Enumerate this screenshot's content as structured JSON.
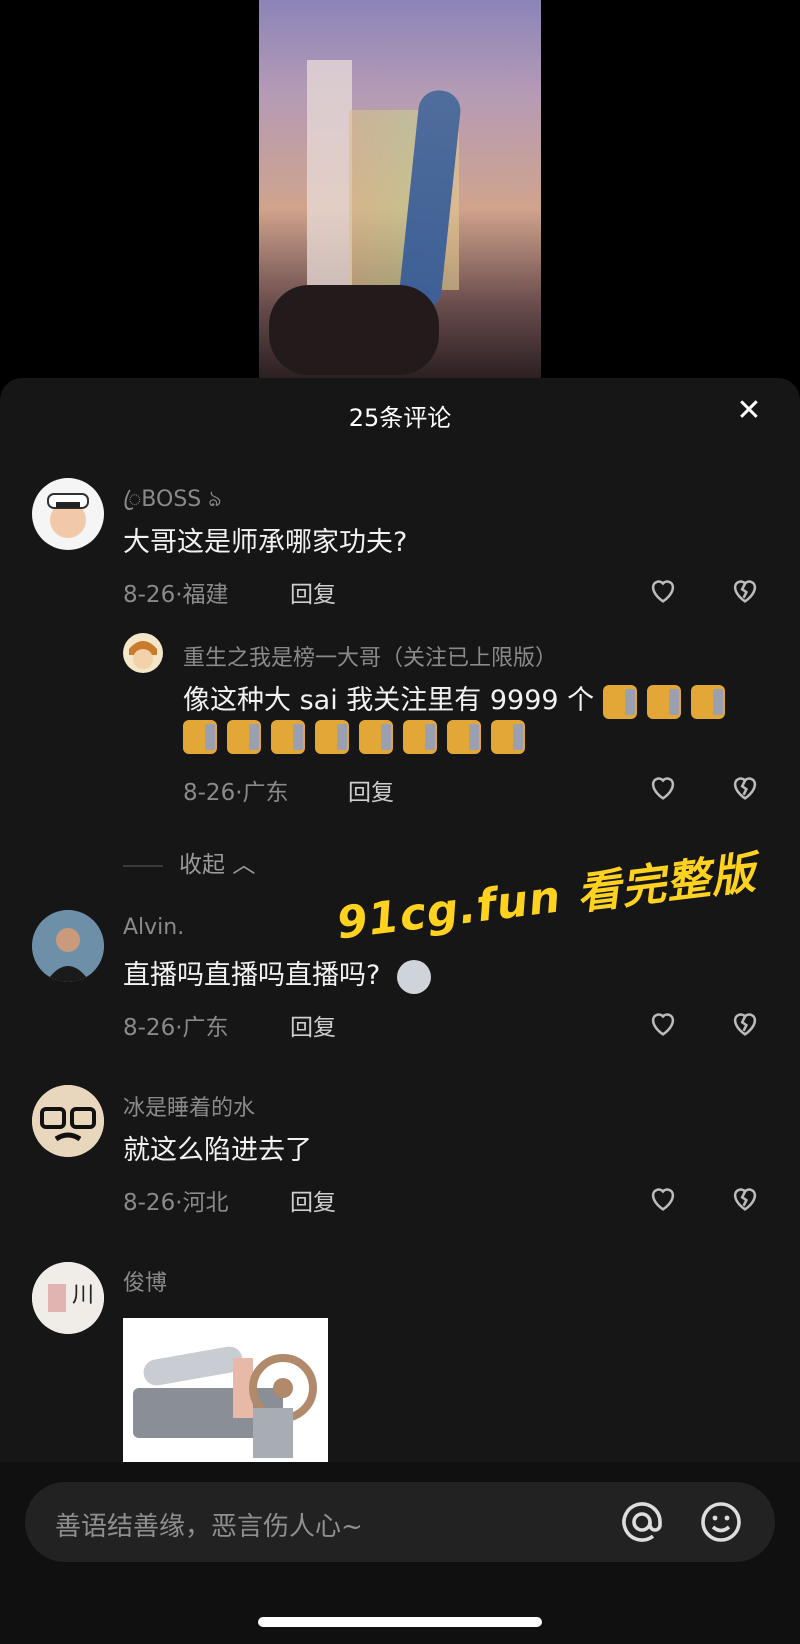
{
  "header": {
    "title": "25条评论"
  },
  "comments": [
    {
      "name": "ꦿBOSS ঌ",
      "text": "大哥这是师承哪家功夫?",
      "date": "8-26·福建",
      "reply": "回复"
    },
    {
      "name": "重生之我是榜一大哥（关注已上限版）",
      "text": "像这种大 sai 我关注里有 9999 个",
      "date": "8-26·广东",
      "reply": "回复"
    },
    {
      "name": "Alvin.",
      "text": "直播吗直播吗直播吗?",
      "date": "8-26·广东",
      "reply": "回复"
    },
    {
      "name": "冰是睡着的水",
      "text": "就这么陷进去了",
      "date": "8-26·河北",
      "reply": "回复"
    },
    {
      "name": "俊博"
    }
  ],
  "collapse_label": "收起",
  "watermark": "91cg.fun 看完整版",
  "input": {
    "placeholder": "善语结善缘，恶言伤人心~"
  },
  "icons": [
    "close-icon",
    "heart-icon",
    "broken-heart-icon",
    "at-icon",
    "emoji-icon"
  ],
  "colors": {
    "watermark": "#ffd21f",
    "sheet": "#161616"
  }
}
